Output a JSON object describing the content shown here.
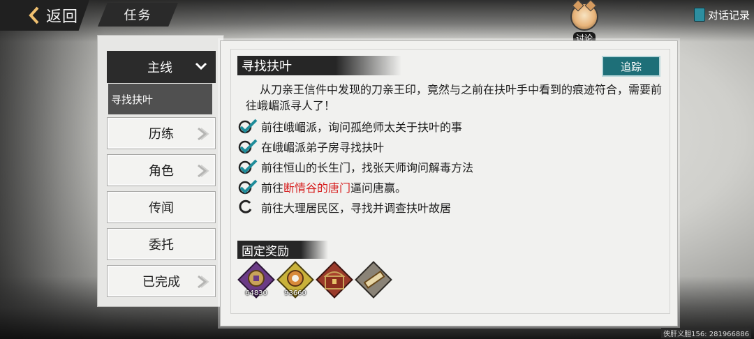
{
  "topbar": {
    "back_label": "返回",
    "title": "任务",
    "discuss_label": "讨论",
    "dialog_log_label": "对话记录"
  },
  "sidebar": {
    "main_tab": "主线",
    "selected_quest": "寻找扶叶",
    "categories": [
      {
        "label": "历练",
        "has_arrow": true
      },
      {
        "label": "角色",
        "has_arrow": true
      },
      {
        "label": "传闻",
        "has_arrow": false
      },
      {
        "label": "委托",
        "has_arrow": false
      },
      {
        "label": "已完成",
        "has_arrow": true
      }
    ]
  },
  "quest": {
    "title": "寻找扶叶",
    "track_label": "追踪",
    "description": "从刀亲王信件中发现的刀亲王印，竟然与之前在扶叶手中看到的痕迹符合，需要前往峨嵋派寻人了！",
    "steps": [
      {
        "text": "前往峨嵋派，询问孤绝师太关于扶叶的事",
        "status": "done"
      },
      {
        "text": "在峨嵋派弟子房寻找扶叶",
        "status": "done"
      },
      {
        "text": "前往恒山的长生门，找张天师询问解毒方法",
        "status": "done"
      },
      {
        "prefix": "前往",
        "highlight": "断情谷的唐门",
        "suffix": "逼问唐赢。",
        "status": "done"
      },
      {
        "text": "前往大理居民区，寻找并调查扶叶故居",
        "status": "in-progress"
      }
    ]
  },
  "rewards": {
    "header": "固定奖励",
    "items": [
      {
        "icon": "copper-coin-icon",
        "count": "64830"
      },
      {
        "icon": "experience-medal-icon",
        "count": "93660"
      },
      {
        "icon": "treasure-chest-icon",
        "count": ""
      },
      {
        "icon": "scroll-icon",
        "count": ""
      }
    ]
  },
  "watermark": "侠肝义胆156: 281966886",
  "colors": {
    "accent_track": "#1e6f78",
    "highlight_red": "#d61f1f",
    "check_teal": "#1f8c9a"
  }
}
